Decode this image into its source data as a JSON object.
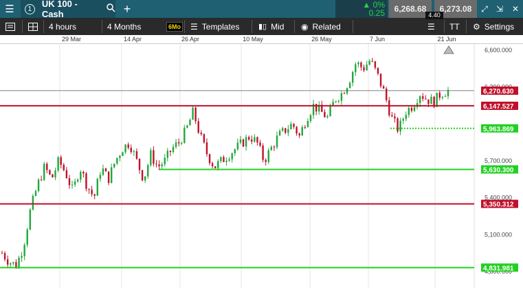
{
  "topbar": {
    "menu_icon": "hamburger-menu-icon",
    "tab_number": "1",
    "instrument": "UK 100 - Cash",
    "change_pct": "0%",
    "change_abs": "0.25",
    "sell_price": "6,268.68",
    "buy_price": "6,273.08",
    "spread": "4.40",
    "window_icons": [
      "expand-icon",
      "collapse-icon",
      "close-icon"
    ],
    "up_color": "#2bd14a"
  },
  "toolbar": {
    "interval": "4 hours",
    "range": "4 Months",
    "range_badge": "6Mo",
    "templates": "Templates",
    "price_type": "Mid",
    "related": "Related",
    "text_tool": "TT",
    "settings": "Settings"
  },
  "dates": [
    "29 Mar",
    "14 Apr",
    "26 Apr",
    "10 May",
    "26 May",
    "7 Jun",
    "21 Jun"
  ],
  "price_axis": [
    "6,600.000",
    "6,300.000",
    "5,700.000",
    "5,400.000",
    "5,100.000",
    "4,800.000"
  ],
  "levels": [
    {
      "label": "6,270.630",
      "value": 6270.63,
      "kind": "current",
      "color": "#c0102a"
    },
    {
      "label": "6,147.527",
      "value": 6147.527,
      "kind": "resistance",
      "color": "#c0102a"
    },
    {
      "label": "5,963.869",
      "value": 5963.869,
      "kind": "support-dotted",
      "color": "#22d022"
    },
    {
      "label": "5,630.300",
      "value": 5630.3,
      "kind": "support",
      "color": "#22d022"
    },
    {
      "label": "5,350.312",
      "value": 5350.312,
      "kind": "resistance",
      "color": "#c0102a"
    },
    {
      "label": "4,831.981",
      "value": 4831.981,
      "kind": "support",
      "color": "#22d022"
    }
  ],
  "chart_data": {
    "type": "candlestick",
    "ylim": [
      4750,
      6650
    ],
    "close_path": [
      4950,
      4880,
      4850,
      5000,
      5300,
      5500,
      5650,
      5550,
      5700,
      5600,
      5450,
      5650,
      5500,
      5400,
      5650,
      5550,
      5700,
      5800,
      5850,
      5700,
      5550,
      5750,
      5650,
      5700,
      5800,
      5850,
      5950,
      6100,
      5900,
      5750,
      5650,
      5700,
      5750,
      5800,
      5850,
      5900,
      5850,
      5700,
      5800,
      5900,
      5950,
      6000,
      5900,
      6050,
      6150,
      6100,
      6050,
      6200,
      6250,
      6350,
      6500,
      6450,
      6520,
      6400,
      6250,
      6050,
      5950,
      6100,
      6150,
      6250,
      6200,
      6180,
      6250,
      6270
    ]
  }
}
